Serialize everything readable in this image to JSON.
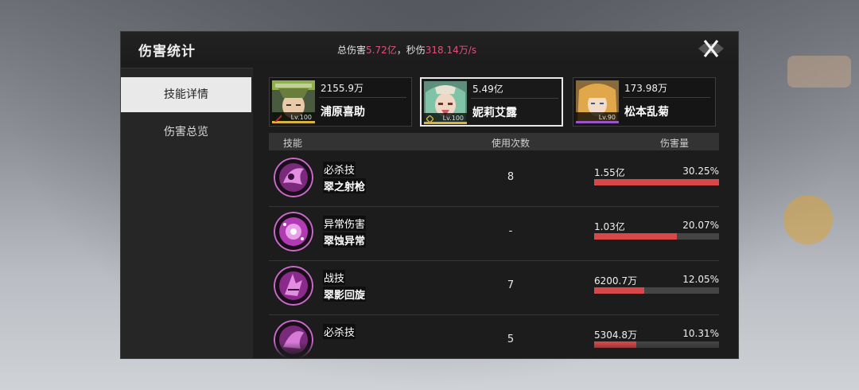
{
  "panel": {
    "title": "伤害统计",
    "summary": {
      "total_label": "总伤害",
      "total_value": "5.72亿",
      "separator": "，",
      "dps_label": "秒伤",
      "dps_value": "318.14万/s"
    },
    "close_icon": "close-x-icon"
  },
  "sidebar": {
    "items": [
      {
        "label": "技能详情",
        "active": true
      },
      {
        "label": "伤害总览",
        "active": false
      }
    ]
  },
  "characters": [
    {
      "damage": "2155.9万",
      "name": "浦原喜助",
      "level": "Lv.100",
      "selected": false,
      "level_bar_color": "#d9b43a",
      "rank_color": "#c72222"
    },
    {
      "damage": "5.49亿",
      "name": "妮莉艾露",
      "level": "Lv.100",
      "selected": true,
      "level_bar_color": "#d9b43a",
      "rank_color": "#d9b43a"
    },
    {
      "damage": "173.98万",
      "name": "松本乱菊",
      "level": "Lv.90",
      "selected": false,
      "level_bar_color": "#9a55c8",
      "rank_color": "#9a55c8"
    }
  ],
  "table": {
    "headers": {
      "skill": "技能",
      "uses": "使用次数",
      "damage": "伤害量"
    },
    "rows": [
      {
        "type": "必杀技",
        "name": "翠之射枪",
        "uses": "8",
        "damage": "1.55亿",
        "percent": "30.25%",
        "bar_fraction": 1.0
      },
      {
        "type": "异常伤害",
        "name": "翠蚀异常",
        "uses": "-",
        "damage": "1.03亿",
        "percent": "20.07%",
        "bar_fraction": 0.66
      },
      {
        "type": "战技",
        "name": "翠影回旋",
        "uses": "7",
        "damage": "6200.7万",
        "percent": "12.05%",
        "bar_fraction": 0.4
      },
      {
        "type": "必杀技",
        "name": "",
        "uses": "5",
        "damage": "5304.8万",
        "percent": "10.31%",
        "bar_fraction": 0.34
      }
    ]
  },
  "colors": {
    "accent": "#e2517a",
    "bar": "#d94848"
  }
}
